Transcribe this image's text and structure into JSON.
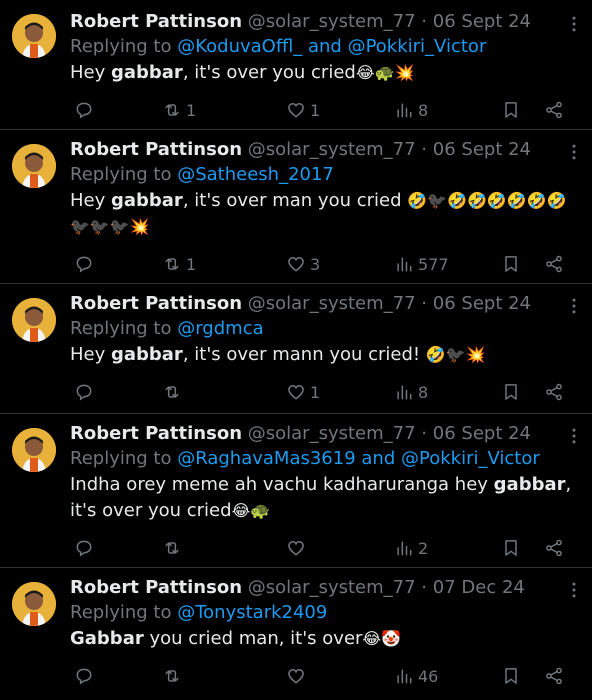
{
  "tweets": [
    {
      "author": "Robert Pattinson",
      "handle": "@solar_system_77",
      "separator": "·",
      "date": "06 Sept 24",
      "replying_prefix": "Replying to",
      "mentions": [
        "@KoduvaOffl_",
        "@Pokkiri_Victor"
      ],
      "mention_joiner": "and",
      "text_parts": [
        "Hey ",
        "gabbar",
        ", it's over you cried"
      ],
      "emoji_line1": "😂🐢💥",
      "emoji_line2": "",
      "replies": "",
      "retweets": "1",
      "likes": "1",
      "views": "8"
    },
    {
      "author": "Robert Pattinson",
      "handle": "@solar_system_77",
      "separator": "·",
      "date": "06 Sept 24",
      "replying_prefix": "Replying to",
      "mentions": [
        "@Satheesh_2017"
      ],
      "mention_joiner": "",
      "text_parts": [
        "Hey ",
        "gabbar",
        ", it's over man you cried "
      ],
      "emoji_line1": "🤣🐦‍⬛🤣🤣🤣🤣🤣🤣",
      "emoji_line2": "🐦‍⬛🐦‍⬛🐦‍⬛💥",
      "replies": "",
      "retweets": "1",
      "likes": "3",
      "views": "577"
    },
    {
      "author": "Robert Pattinson",
      "handle": "@solar_system_77",
      "separator": "·",
      "date": "06 Sept 24",
      "replying_prefix": "Replying to",
      "mentions": [
        "@rgdmca"
      ],
      "mention_joiner": "",
      "text_parts": [
        "Hey ",
        "gabbar",
        ", it's over mann you cried! "
      ],
      "emoji_line1": "🤣🐦‍⬛💥",
      "emoji_line2": "",
      "replies": "",
      "retweets": "",
      "likes": "1",
      "views": "8"
    },
    {
      "author": "Robert Pattinson",
      "handle": "@solar_system_77",
      "separator": "·",
      "date": "06 Sept 24",
      "replying_prefix": "Replying to",
      "mentions": [
        "@RaghavaMas3619",
        "@Pokkiri_Victor"
      ],
      "mention_joiner": "and",
      "text_parts": [
        "Indha orey meme ah vachu kadharuranga hey ",
        "gabbar",
        ", it's over you cried"
      ],
      "emoji_line1": "😂🐢",
      "emoji_line2": "",
      "replies": "",
      "retweets": "",
      "likes": "",
      "views": "2"
    },
    {
      "author": "Robert Pattinson",
      "handle": "@solar_system_77",
      "separator": "·",
      "date": "07 Dec 24",
      "replying_prefix": "Replying to",
      "mentions": [
        "@Tonystark2409"
      ],
      "mention_joiner": "",
      "text_parts": [
        "",
        "Gabbar",
        " you cried man, it's over"
      ],
      "emoji_line1": "😂🤡",
      "emoji_line2": "",
      "replies": "",
      "retweets": "",
      "likes": "",
      "views": "46"
    }
  ],
  "colors": {
    "background": "#000000",
    "text": "#e7e9ea",
    "muted": "#71767b",
    "link": "#1d9bf0",
    "divider": "#2f3336"
  },
  "icons": {
    "reply": "reply-icon",
    "retweet": "retweet-icon",
    "like": "heart-icon",
    "views": "views-chart-icon",
    "bookmark": "bookmark-icon",
    "share": "share-icon",
    "more": "more-options-icon"
  }
}
